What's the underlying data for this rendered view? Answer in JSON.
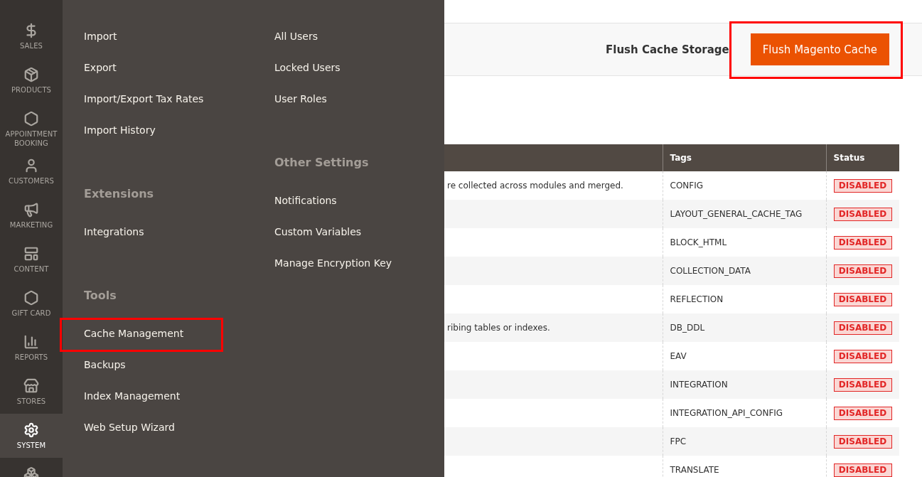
{
  "sidebar": {
    "items": [
      {
        "label": "SALES",
        "selected": false
      },
      {
        "label": "PRODUCTS",
        "selected": false
      },
      {
        "label": "APPOINTMENT BOOKING",
        "selected": false
      },
      {
        "label": "CUSTOMERS",
        "selected": false
      },
      {
        "label": "MARKETING",
        "selected": false
      },
      {
        "label": "CONTENT",
        "selected": false
      },
      {
        "label": "GIFT CARD",
        "selected": false
      },
      {
        "label": "REPORTS",
        "selected": false
      },
      {
        "label": "STORES",
        "selected": false
      },
      {
        "label": "SYSTEM",
        "selected": true
      },
      {
        "selected": false
      }
    ]
  },
  "menu": {
    "columns": [
      {
        "sections": [
          {
            "items": [
              {
                "label": "Import",
                "highlighted": false
              },
              {
                "label": "Export",
                "highlighted": false
              },
              {
                "label": "Import/Export Tax Rates",
                "highlighted": false
              },
              {
                "label": "Import History",
                "highlighted": false
              }
            ]
          },
          {
            "title": "Extensions",
            "items": [
              {
                "label": "Integrations",
                "highlighted": false
              }
            ]
          },
          {
            "title": "Tools",
            "items": [
              {
                "label": "Cache Management",
                "highlighted": true
              },
              {
                "label": "Backups",
                "highlighted": false
              },
              {
                "label": "Index Management",
                "highlighted": false
              },
              {
                "label": "Web Setup Wizard",
                "highlighted": false
              }
            ]
          }
        ]
      },
      {
        "sections": [
          {
            "items": [
              {
                "label": "All Users",
                "highlighted": false
              },
              {
                "label": "Locked Users",
                "highlighted": false
              },
              {
                "label": "User Roles",
                "highlighted": false
              }
            ]
          },
          {
            "title": "Other Settings",
            "items": [
              {
                "label": "Notifications",
                "highlighted": false
              },
              {
                "label": "Custom Variables",
                "highlighted": false
              },
              {
                "label": "Manage Encryption Key",
                "highlighted": false
              }
            ]
          }
        ]
      }
    ]
  },
  "actions": {
    "secondary": "Flush Cache Storage",
    "primary": {
      "label": "Flush Magento Cache",
      "highlighted": true
    }
  },
  "table": {
    "columns": [
      "Tags",
      "Status"
    ],
    "rows": [
      {
        "column_1": "re collected across modules and merged.",
        "tags": "CONFIG",
        "status": {
          "label": "DISABLED",
          "kind": "disabled"
        }
      },
      {
        "tags": "LAYOUT_GENERAL_CACHE_TAG",
        "status": {
          "label": "DISABLED",
          "kind": "disabled"
        }
      },
      {
        "tags": "BLOCK_HTML",
        "status": {
          "label": "DISABLED",
          "kind": "disabled"
        }
      },
      {
        "tags": "COLLECTION_DATA",
        "status": {
          "label": "DISABLED",
          "kind": "disabled"
        }
      },
      {
        "tags": "REFLECTION",
        "status": {
          "label": "DISABLED",
          "kind": "disabled"
        }
      },
      {
        "column_1": "ribing tables or indexes.",
        "tags": "DB_DDL",
        "status": {
          "label": "DISABLED",
          "kind": "disabled"
        }
      },
      {
        "tags": "EAV",
        "status": {
          "label": "DISABLED",
          "kind": "disabled"
        }
      },
      {
        "tags": "INTEGRATION",
        "status": {
          "label": "DISABLED",
          "kind": "disabled"
        }
      },
      {
        "tags": "INTEGRATION_API_CONFIG",
        "status": {
          "label": "DISABLED",
          "kind": "disabled"
        }
      },
      {
        "tags": "FPC",
        "status": {
          "label": "DISABLED",
          "kind": "disabled"
        }
      },
      {
        "tags": "TRANSLATE",
        "status": {
          "label": "DISABLED",
          "kind": "disabled"
        }
      }
    ]
  }
}
